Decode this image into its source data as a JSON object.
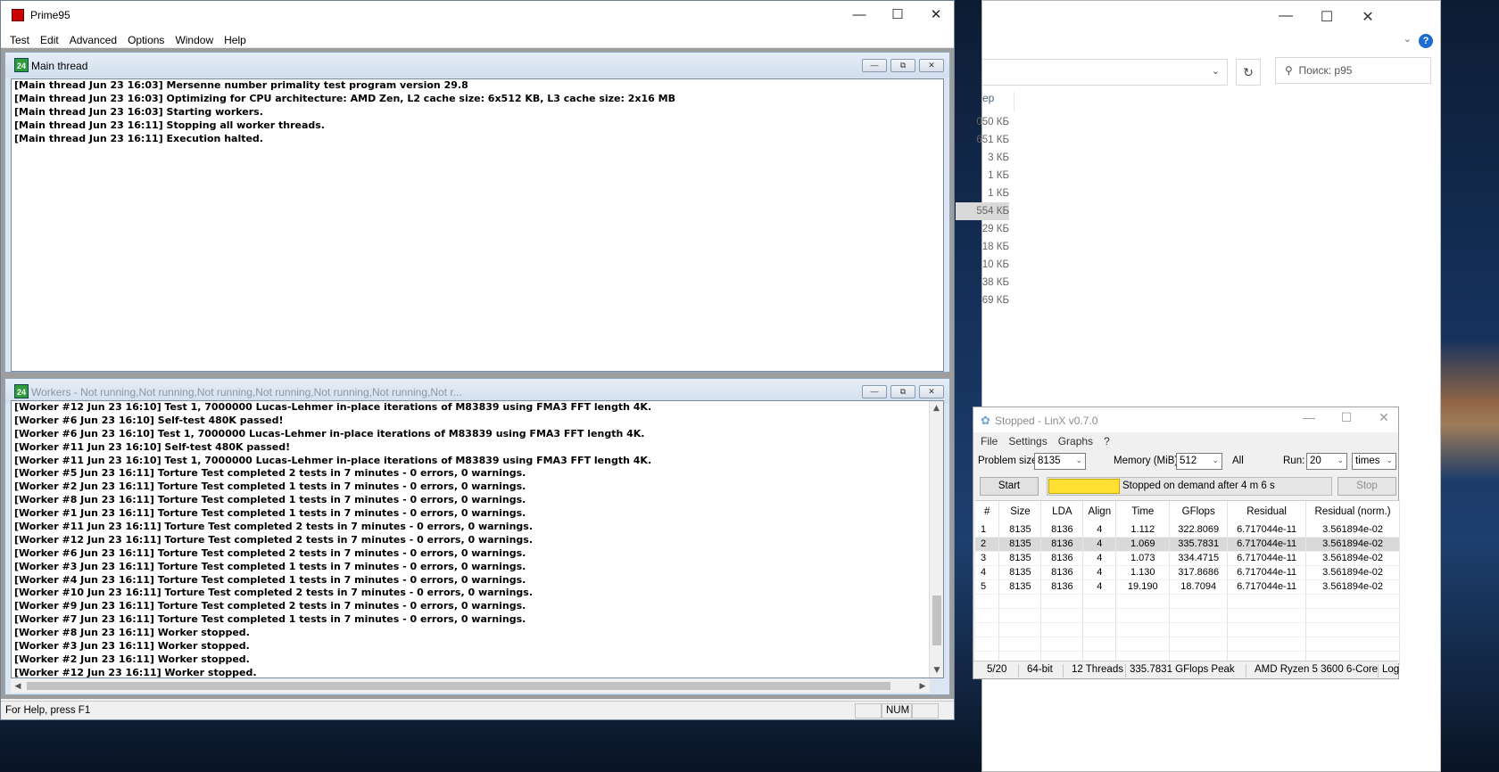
{
  "explorer": {
    "search_placeholder": "Поиск: p95",
    "column_header_partial": "ер",
    "help_label": "?",
    "sizes": [
      "050 КБ",
      "651 КБ",
      "3 КБ",
      "1 КБ",
      "1 КБ",
      "554 КБ",
      "29 КБ",
      "18 КБ",
      "10 КБ",
      "38 КБ",
      "69 КБ"
    ],
    "selected_size_index": 5
  },
  "prime95": {
    "title": "Prime95",
    "menu": [
      "Test",
      "Edit",
      "Advanced",
      "Options",
      "Window",
      "Help"
    ],
    "main_thread": {
      "title": "Main thread",
      "icon_text": "24",
      "lines": [
        "[Main thread Jun 23 16:03] Mersenne number primality test program version 29.8",
        "[Main thread Jun 23 16:03] Optimizing for CPU architecture: AMD Zen, L2 cache size: 6x512 KB, L3 cache size: 2x16 MB",
        "[Main thread Jun 23 16:03] Starting workers.",
        "[Main thread Jun 23 16:11] Stopping all worker threads.",
        "[Main thread Jun 23 16:11] Execution halted."
      ]
    },
    "workers": {
      "title": "Workers - Not running,Not running,Not running,Not running,Not running,Not running,Not r...",
      "icon_text": "24",
      "lines": [
        "[Worker #12 Jun 23 16:10] Test 1, 7000000 Lucas-Lehmer in-place iterations of M83839 using FMA3 FFT length 4K.",
        "[Worker #6 Jun 23 16:10] Self-test 480K passed!",
        "[Worker #6 Jun 23 16:10] Test 1, 7000000 Lucas-Lehmer in-place iterations of M83839 using FMA3 FFT length 4K.",
        "[Worker #11 Jun 23 16:10] Self-test 480K passed!",
        "[Worker #11 Jun 23 16:10] Test 1, 7000000 Lucas-Lehmer in-place iterations of M83839 using FMA3 FFT length 4K.",
        "[Worker #5 Jun 23 16:11] Torture Test completed 2 tests in 7 minutes - 0 errors, 0 warnings.",
        "[Worker #2 Jun 23 16:11] Torture Test completed 1 tests in 7 minutes - 0 errors, 0 warnings.",
        "[Worker #8 Jun 23 16:11] Torture Test completed 1 tests in 7 minutes - 0 errors, 0 warnings.",
        "[Worker #1 Jun 23 16:11] Torture Test completed 1 tests in 7 minutes - 0 errors, 0 warnings.",
        "[Worker #11 Jun 23 16:11] Torture Test completed 2 tests in 7 minutes - 0 errors, 0 warnings.",
        "[Worker #12 Jun 23 16:11] Torture Test completed 2 tests in 7 minutes - 0 errors, 0 warnings.",
        "[Worker #6 Jun 23 16:11] Torture Test completed 2 tests in 7 minutes - 0 errors, 0 warnings.",
        "[Worker #3 Jun 23 16:11] Torture Test completed 1 tests in 7 minutes - 0 errors, 0 warnings.",
        "[Worker #4 Jun 23 16:11] Torture Test completed 1 tests in 7 minutes - 0 errors, 0 warnings.",
        "[Worker #10 Jun 23 16:11] Torture Test completed 2 tests in 7 minutes - 0 errors, 0 warnings.",
        "[Worker #9 Jun 23 16:11] Torture Test completed 2 tests in 7 minutes - 0 errors, 0 warnings.",
        "[Worker #7 Jun 23 16:11] Torture Test completed 1 tests in 7 minutes - 0 errors, 0 warnings.",
        "[Worker #8 Jun 23 16:11] Worker stopped.",
        "[Worker #3 Jun 23 16:11] Worker stopped.",
        "[Worker #2 Jun 23 16:11] Worker stopped.",
        "[Worker #12 Jun 23 16:11] Worker stopped."
      ]
    },
    "status": {
      "help_text": "For Help, press F1",
      "num": "NUM"
    }
  },
  "linx": {
    "title": "Stopped - LinX v0.7.0",
    "menu": [
      "File",
      "Settings",
      "Graphs",
      "?"
    ],
    "problem_size_label": "Problem size:",
    "problem_size": "8135",
    "memory_label": "Memory (MiB):",
    "memory": "512",
    "all_label": "All",
    "run_label": "Run:",
    "run_value": "20",
    "run_unit": "times",
    "start_label": "Start",
    "stop_label": "Stop",
    "progress_fraction": 0.25,
    "progress_text": "Stopped on demand after 4 m 6 s",
    "columns": [
      "#",
      "Size",
      "LDA",
      "Align",
      "Time",
      "GFlops",
      "Residual",
      "Residual (norm.)"
    ],
    "rows": [
      [
        "1",
        "8135",
        "8136",
        "4",
        "1.112",
        "322.8069",
        "6.717044e-11",
        "3.561894e-02"
      ],
      [
        "2",
        "8135",
        "8136",
        "4",
        "1.069",
        "335.7831",
        "6.717044e-11",
        "3.561894e-02"
      ],
      [
        "3",
        "8135",
        "8136",
        "4",
        "1.073",
        "334.4715",
        "6.717044e-11",
        "3.561894e-02"
      ],
      [
        "4",
        "8135",
        "8136",
        "4",
        "1.130",
        "317.8686",
        "6.717044e-11",
        "3.561894e-02"
      ],
      [
        "5",
        "8135",
        "8136",
        "4",
        "19.190",
        "18.7094",
        "6.717044e-11",
        "3.561894e-02"
      ]
    ],
    "selected_row": 1,
    "status": {
      "runs": "5/20",
      "bits": "64-bit",
      "threads": "12 Threads",
      "peak": "335.7831 GFlops Peak",
      "cpu": "AMD Ryzen 5 3600 6-Core",
      "log": "Log"
    }
  }
}
